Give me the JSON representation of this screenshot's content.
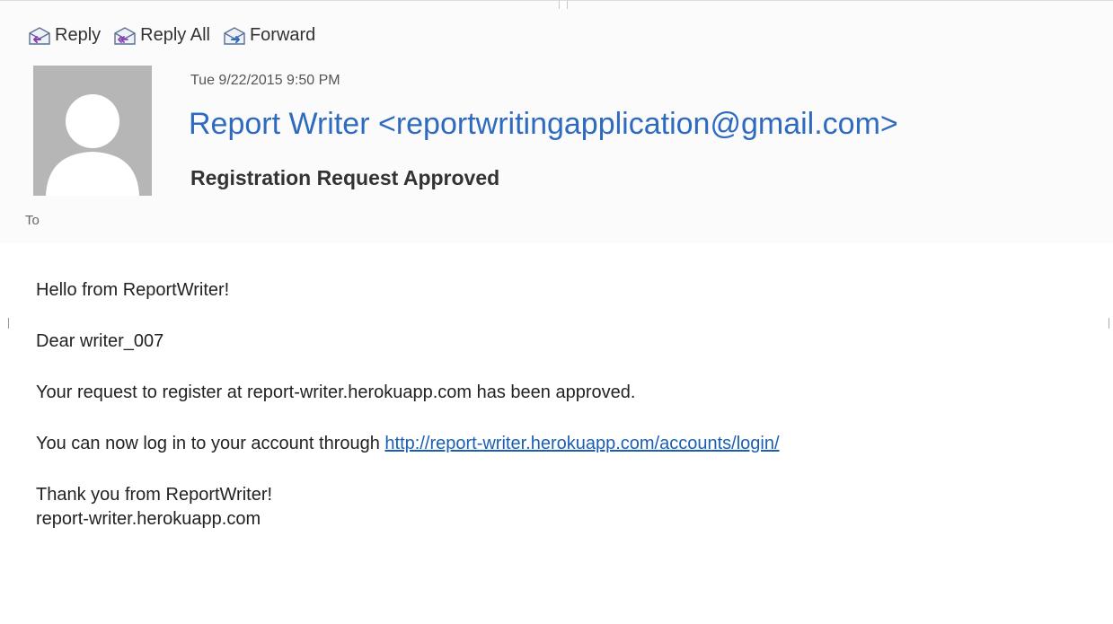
{
  "toolbar": {
    "reply_label": "Reply",
    "reply_all_label": "Reply All",
    "forward_label": "Forward",
    "reply_icon": "reply-envelope-icon",
    "reply_all_icon": "reply-all-envelope-icon",
    "forward_icon": "forward-envelope-icon"
  },
  "message": {
    "datetime": "Tue 9/22/2015 9:50 PM",
    "sender": "Report Writer <reportwritingapplication@gmail.com>",
    "subject": "Registration Request Approved",
    "to_label": "To",
    "avatar_icon": "default-person-avatar-icon"
  },
  "body": {
    "greeting": "Hello from ReportWriter!",
    "salutation": "Dear writer_007",
    "approval_text": "Your request to register at report-writer.herokuapp.com has been approved.",
    "login_text": "You can now log in to your account through ",
    "login_link": "http://report-writer.herokuapp.com/accounts/login/",
    "closing": "Thank you from ReportWriter!",
    "signature": "report-writer.herokuapp.com"
  },
  "colors": {
    "sender_blue": "#2e6bbf",
    "link_blue": "#1a5fb4",
    "avatar_gray": "#b6b6b6",
    "header_bg": "#fbfbfb"
  }
}
